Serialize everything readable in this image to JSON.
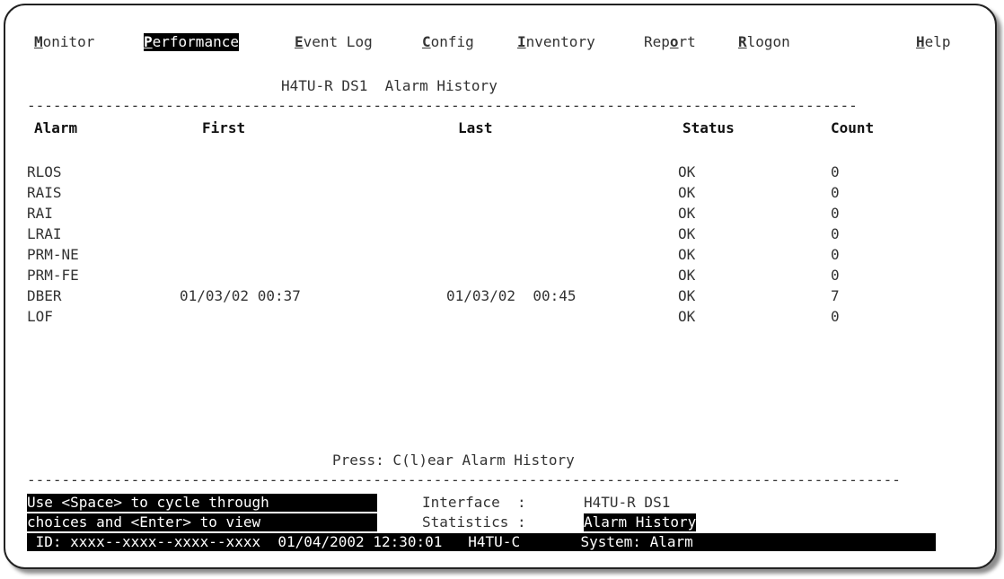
{
  "menu": [
    {
      "hot": "M",
      "rest": "onitor"
    },
    {
      "hot": "P",
      "rest": "erformance"
    },
    {
      "hot": "E",
      "rest": "vent Log"
    },
    {
      "hot": "C",
      "rest": "onfig"
    },
    {
      "hot": "I",
      "rest": "nventory"
    },
    {
      "pre": "Rep",
      "hot": "o",
      "rest": "rt"
    },
    {
      "hot": "R",
      "rest": "logon"
    },
    {
      "hot": "H",
      "rest": "elp"
    }
  ],
  "title": "H4TU-R DS1  Alarm History",
  "headers": {
    "alarm": "Alarm",
    "first": "First",
    "last": "Last",
    "status": "Status",
    "count": "Count"
  },
  "rows": [
    {
      "alarm": "RLOS",
      "first": "",
      "last": "",
      "status": "OK",
      "count": "0"
    },
    {
      "alarm": "RAIS",
      "first": "",
      "last": "",
      "status": "OK",
      "count": "0"
    },
    {
      "alarm": "RAI",
      "first": "",
      "last": "",
      "status": "OK",
      "count": "0"
    },
    {
      "alarm": "LRAI",
      "first": "",
      "last": "",
      "status": "OK",
      "count": "0"
    },
    {
      "alarm": "PRM-NE",
      "first": "",
      "last": "",
      "status": "OK",
      "count": "0"
    },
    {
      "alarm": "PRM-FE",
      "first": "",
      "last": "",
      "status": "OK",
      "count": "0"
    },
    {
      "alarm": "DBER",
      "first": "01/03/02 00:37",
      "last": "01/03/02  00:45",
      "status": "OK",
      "count": "7"
    },
    {
      "alarm": "LOF",
      "first": "",
      "last": "",
      "status": "OK",
      "count": "0"
    }
  ],
  "press_hint": "Press: C(l)ear Alarm History",
  "help_line1": "Use <Space> to cycle through",
  "help_line2": "choices and <Enter> to view",
  "interface_label": "Interface  :",
  "interface_value": "H4TU-R DS1",
  "statistics_label": "Statistics :",
  "statistics_value": "Alarm History",
  "status_bar": " ID: xxxx--xxxx--xxxx--xxxx  01/04/2002 12:30:01   H4TU-C       System: Alarm"
}
